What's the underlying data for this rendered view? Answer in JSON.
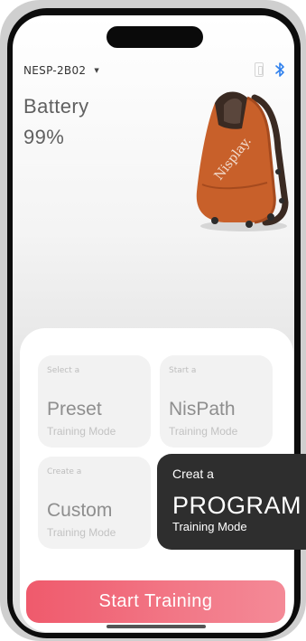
{
  "device": {
    "name": "NESP-2B02",
    "dropdown_icon": "caret-down-icon",
    "phone_icon": "phone-outline-icon",
    "bluetooth_icon": "bluetooth-icon"
  },
  "battery": {
    "label": "Battery",
    "value": "99%"
  },
  "product": {
    "brand_on_bag": "Nisplay."
  },
  "modes": [
    {
      "small": "Select a",
      "big": "Preset",
      "sub": "Training Mode"
    },
    {
      "small": "Start a",
      "big": "NisPath",
      "sub": "Training Mode"
    },
    {
      "small": "Create a",
      "big": "Custom",
      "sub": "Training Mode"
    },
    {
      "small": "Creat a",
      "big": "PROGRAM",
      "sub": "Training Mode"
    }
  ],
  "start_button": {
    "label": "Start Training"
  },
  "colors": {
    "accent": "#ef5a6c",
    "bluetooth": "#2f80ed",
    "program_card": "#2e2e2e",
    "bag": "#c8602a"
  }
}
